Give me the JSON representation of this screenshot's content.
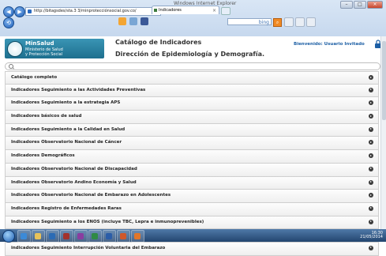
{
  "browser": {
    "address": "http://bitagsdes/sta.3 3/minprotecciónsocial.gov.co/",
    "tab_title": "Indicadores",
    "search_engine": "bing",
    "window_title": "Windows Internet Explorer"
  },
  "header": {
    "logo_name": "MinSalud",
    "logo_sub_1": "Ministerio de Salud",
    "logo_sub_2": "y Protección Social",
    "title": "Catálogo de Indicadores",
    "subtitle": "Dirección de Epidemiología y Demografía.",
    "welcome": "Bienvenido: Usuario Invitado"
  },
  "list": {
    "items": [
      {
        "label": "Catálogo completo"
      },
      {
        "label": "Indicadores Seguimiento a las Actividades Preventivas"
      },
      {
        "label": "Indicadores Seguimiento a la estrategia APS"
      },
      {
        "label": "Indicadores básicos de salud"
      },
      {
        "label": "Indicadores Seguimiento a la Calidad en Salud"
      },
      {
        "label": "Indicadores Observatorio Nacional de Cáncer"
      },
      {
        "label": "Indicadores Demográficos"
      },
      {
        "label": "Indicadores Observatorio Nacional de Discapacidad"
      },
      {
        "label": "Indicadores Observatorio Andino Economía y Salud"
      },
      {
        "label": "Indicadores Observatorio Nacional de Embarazo en Adolescentes"
      },
      {
        "label": "Indicadores Registro de Enfermedades Raras"
      },
      {
        "label": "Indicadores Seguimiento a los ENOS (incluye TBC, Lepra e inmunoprevenibles)"
      },
      {
        "label": "Indicadores Seguimiento a ERC y Cardiovascular"
      },
      {
        "label": "indicadores Seguimiento Interrupción Voluntaria del Embarazo"
      }
    ]
  },
  "taskbar": {
    "time": "16:30",
    "date": "21/05/2014"
  },
  "colors": {
    "brand": "#2a85a8",
    "welcome": "#1d5fa5",
    "taskbar": "#2f5687"
  }
}
